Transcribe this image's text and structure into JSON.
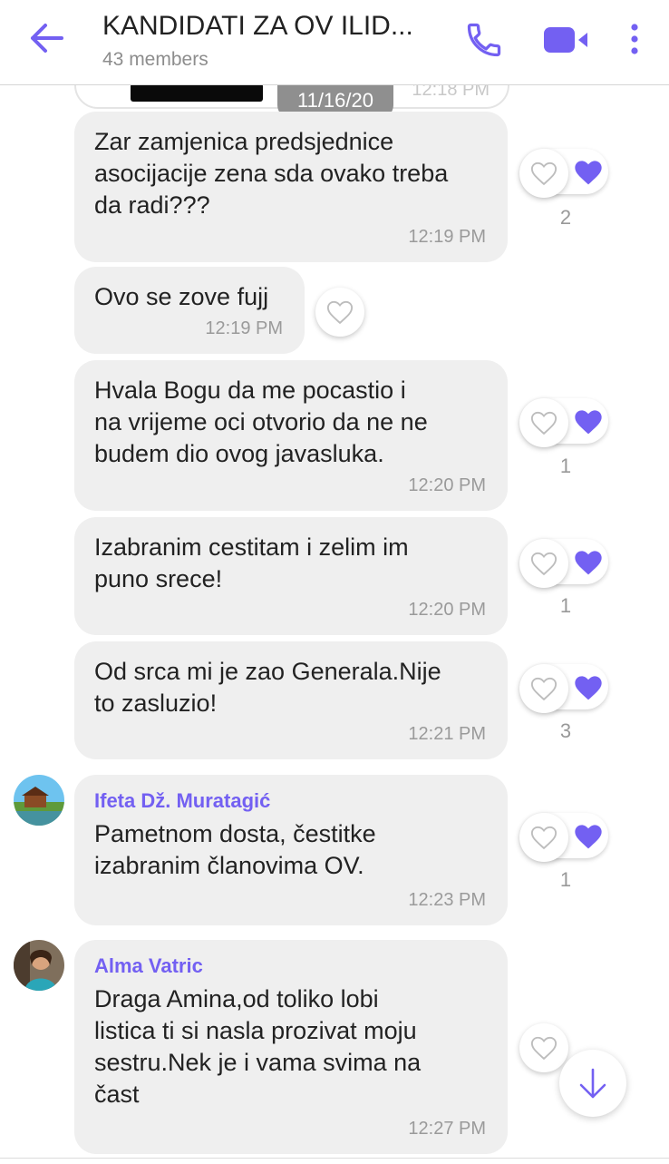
{
  "header": {
    "title": "KANDIDATI ZA OV ILID...",
    "subtitle": "43 members",
    "back_icon": "arrow-left-icon",
    "call_icon": "phone-icon",
    "video_icon": "video-camera-icon",
    "menu_icon": "more-vertical-icon",
    "accent": "#7360f2"
  },
  "previous": {
    "time": "12:18 PM"
  },
  "date_chip": "11/16/20",
  "messages": [
    {
      "text": "Zar zamjenica predsjednice\nasocijacije zena sda ovako treba\nda radi???",
      "time": "12:19 PM",
      "likes": "2"
    },
    {
      "text": "Ovo se zove fujj",
      "time": "12:19 PM"
    },
    {
      "text": "Hvala Bogu da me pocastio i\nna vrijeme oci otvorio da ne ne\nbudem dio ovog javasluka.",
      "time": "12:20 PM",
      "likes": "1"
    },
    {
      "text": "Izabranim cestitam i zelim im\npuno srece!",
      "time": "12:20 PM",
      "likes": "1"
    },
    {
      "text": "Od srca mi je zao Generala.Nije\nto zasluzio!",
      "time": "12:21 PM",
      "likes": "3"
    },
    {
      "sender": "Ifeta Dž. Muratagić",
      "text": "Pametnom dosta, čestitke\nizabranim članovima OV.",
      "time": "12:23 PM",
      "likes": "1"
    },
    {
      "sender": "Alma Vatric",
      "text": "Draga Amina,od toliko lobi\nlistica ti si nasla prozivat moju\nsestru.Nek je i vama svima na\nčast",
      "time": "12:27 PM"
    }
  ],
  "icons": {
    "heart_outline": "heart-outline-icon",
    "heart_filled": "heart-filled-icon",
    "scroll_down": "arrow-down-icon"
  }
}
